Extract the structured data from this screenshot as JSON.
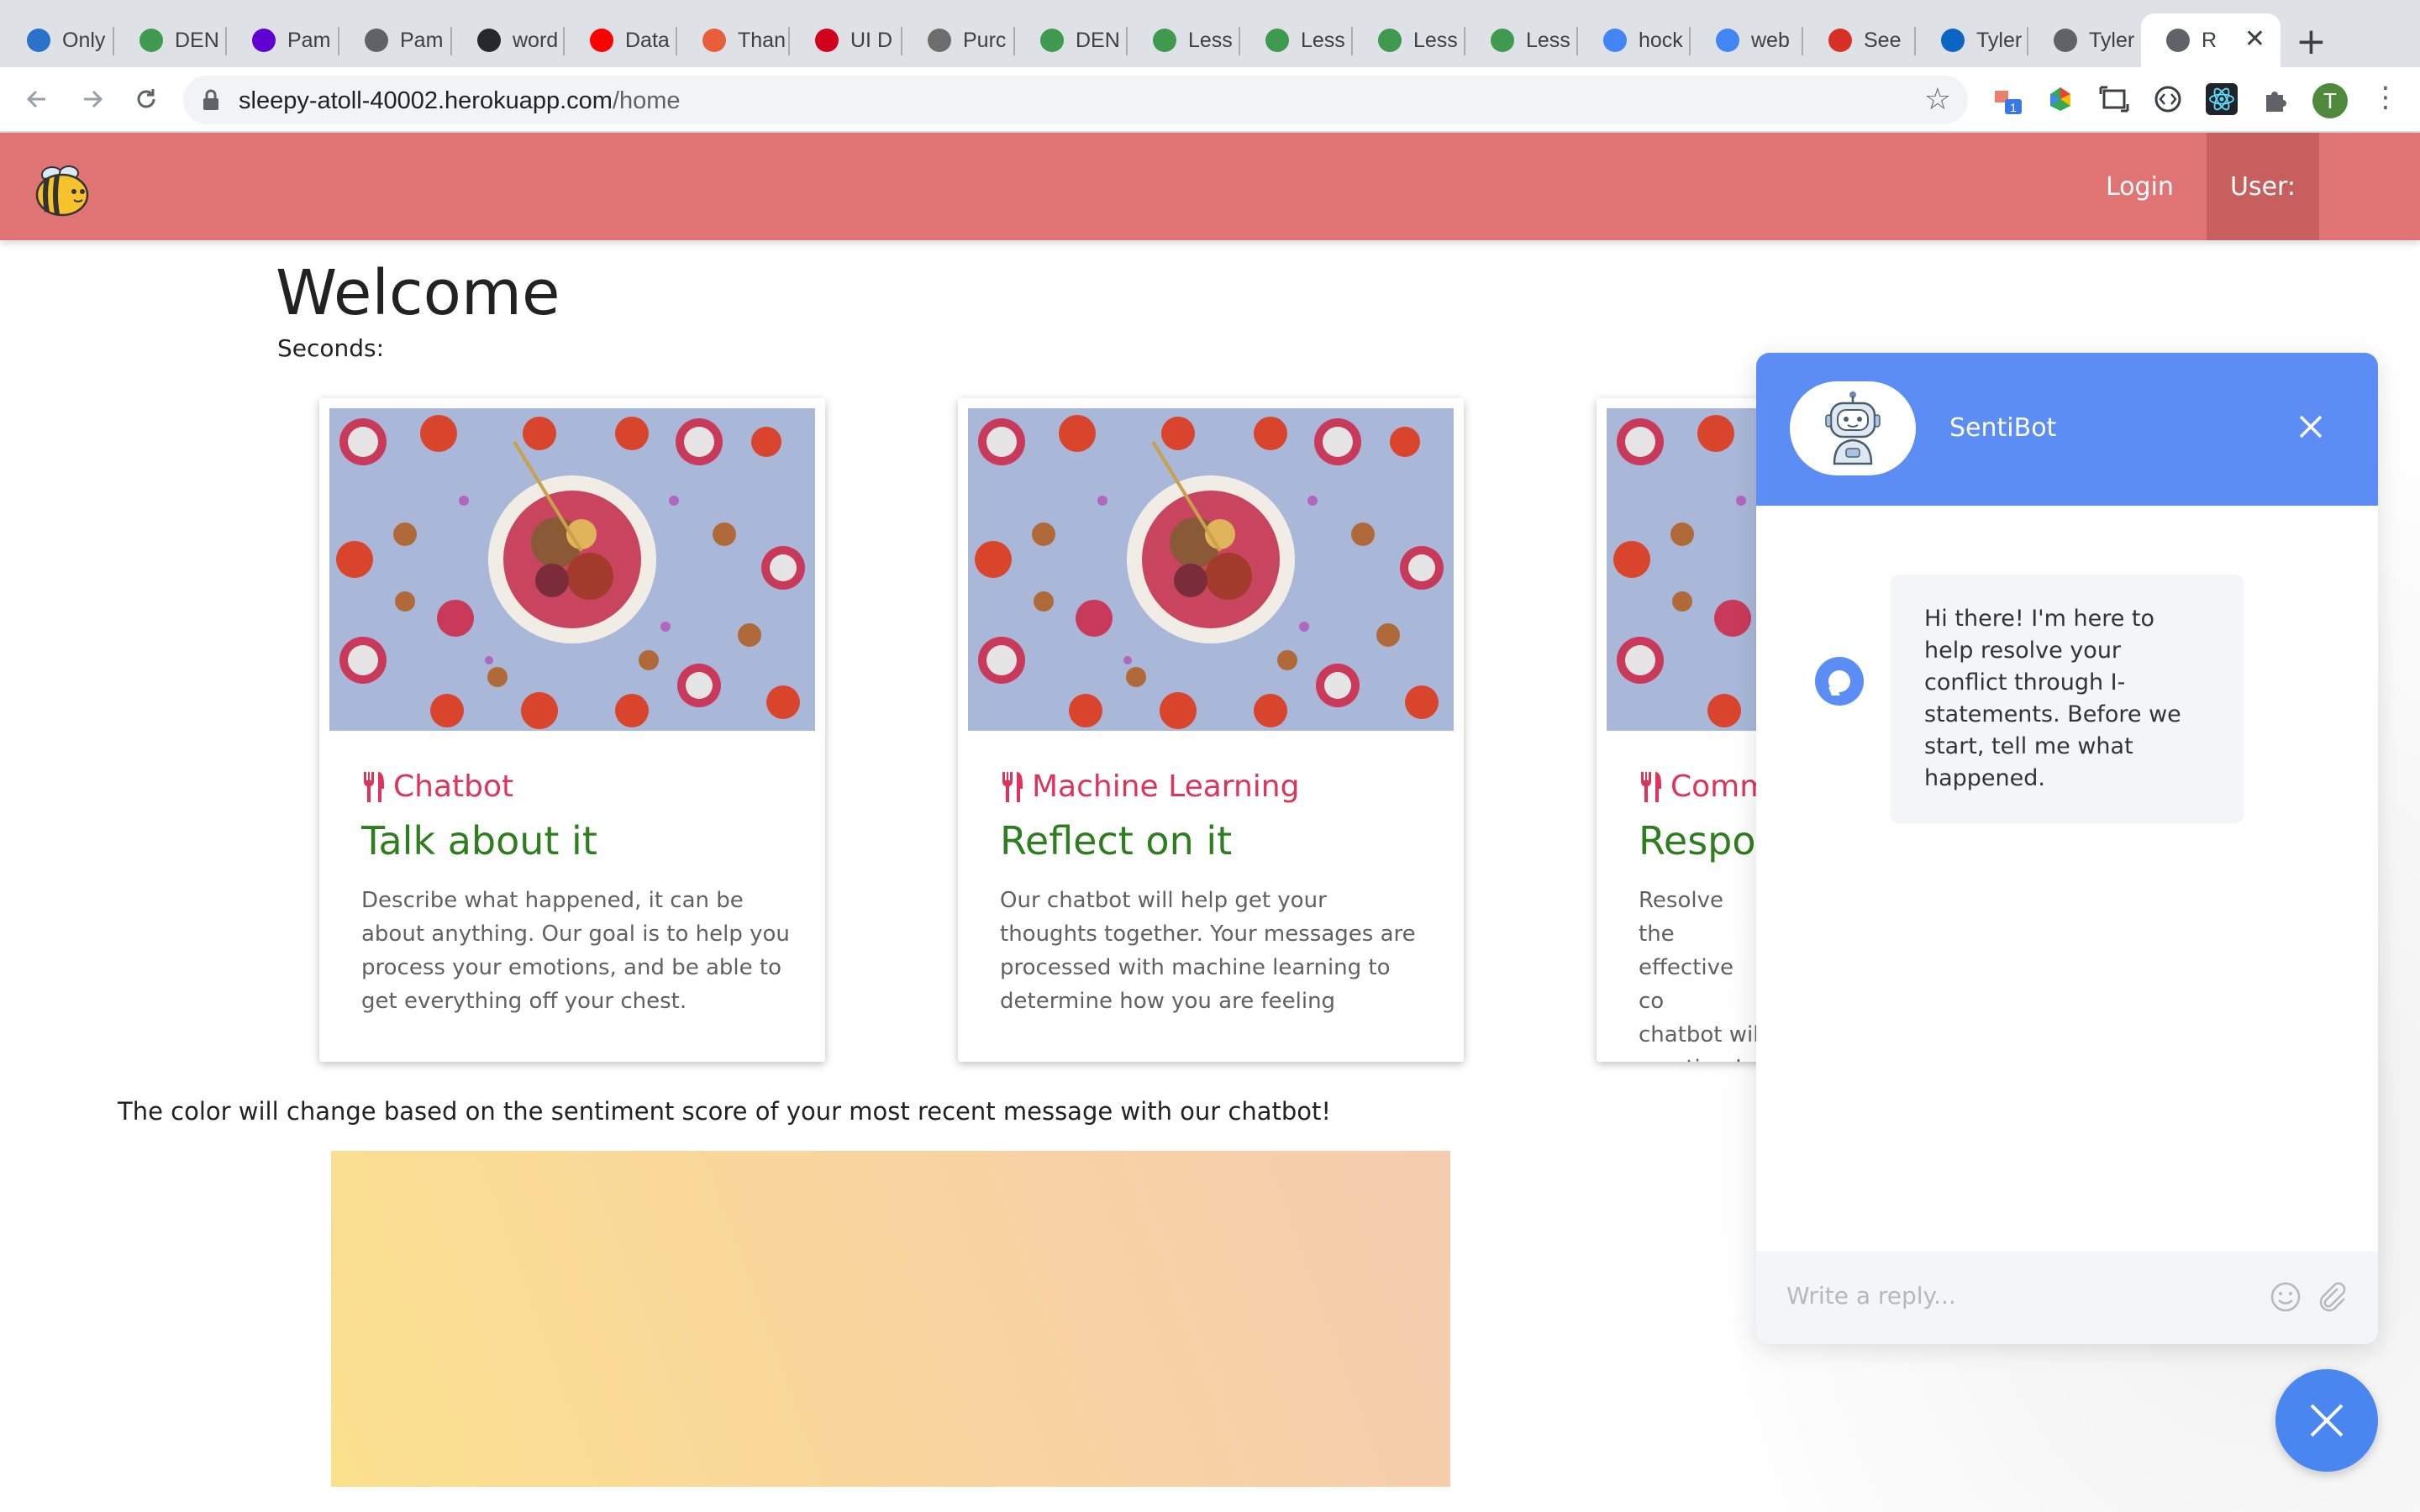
{
  "browser": {
    "tabs": [
      {
        "label": "Only",
        "icon": "mail-icon",
        "color": "#2a73c8"
      },
      {
        "label": "DEN",
        "icon": "cube-icon",
        "color": "#3f9a4f"
      },
      {
        "label": "Pam",
        "icon": "yahoo-icon",
        "color": "#5f01d1"
      },
      {
        "label": "Pam",
        "icon": "globe-icon",
        "color": "#5f6368"
      },
      {
        "label": "word",
        "icon": "github-icon",
        "color": "#24292e"
      },
      {
        "label": "Data",
        "icon": "youtube-icon",
        "color": "#ff0000"
      },
      {
        "label": "Than",
        "icon": "check-circle-icon",
        "color": "#e85d3a"
      },
      {
        "label": "UI D",
        "icon": "dribbble-d-icon",
        "color": "#d0021b"
      },
      {
        "label": "Purc",
        "icon": "tree-icon",
        "color": "#6d6d6d"
      },
      {
        "label": "DEN",
        "icon": "cube-icon",
        "color": "#3f9a4f"
      },
      {
        "label": "Less",
        "icon": "cube-icon",
        "color": "#3f9a4f"
      },
      {
        "label": "Less",
        "icon": "cube-icon",
        "color": "#3f9a4f"
      },
      {
        "label": "Less",
        "icon": "cube-icon",
        "color": "#3f9a4f"
      },
      {
        "label": "Less",
        "icon": "cube-icon",
        "color": "#3f9a4f"
      },
      {
        "label": "hock",
        "icon": "google-icon",
        "color": "#4285f4"
      },
      {
        "label": "web",
        "icon": "google-icon",
        "color": "#4285f4"
      },
      {
        "label": "See",
        "icon": "gmail-icon",
        "color": "#d93025"
      },
      {
        "label": "Tyler",
        "icon": "linkedin-icon",
        "color": "#0a66c2"
      },
      {
        "label": "Tyler",
        "icon": "globe-icon",
        "color": "#5f6368"
      },
      {
        "label": "R",
        "icon": "globe-icon",
        "color": "#5f6368",
        "active": true
      }
    ],
    "new_tab": "+",
    "url_host": "sleepy-atoll-40002.herokuapp.com",
    "url_path": "/home",
    "profile_initial": "T",
    "extension_badge": "1"
  },
  "site": {
    "nav": {
      "login": "Login",
      "user": "User:"
    },
    "welcome": "Welcome",
    "seconds": "Seconds:",
    "cards": [
      {
        "category": "Chatbot",
        "title": "Talk about it",
        "desc": "Describe what happened, it can be about anything. Our goal is to help you process your emotions, and be able to get everything off your chest."
      },
      {
        "category": "Machine Learning",
        "title": "Reflect on it",
        "desc": "Our chatbot will help get your thoughts together. Your messages are processed with machine learning to determine how you are feeling"
      },
      {
        "category": "Comm",
        "title": "Respo",
        "desc": "Resolve the effective co chatbot wil creating I-s"
      }
    ],
    "sentiment_text": "The color will change based on the sentiment score of your most recent message with our chatbot!"
  },
  "chat": {
    "bot_name": "SentiBot",
    "message": "Hi there! I'm here to help resolve your conflict through I-statements. Before we start, tell me what happened.",
    "input_placeholder": "Write a reply..."
  },
  "colors": {
    "header": "#e07373",
    "chat_accent": "#5b8df5",
    "category": "#e0335b",
    "card_title": "#2e7d1e"
  }
}
